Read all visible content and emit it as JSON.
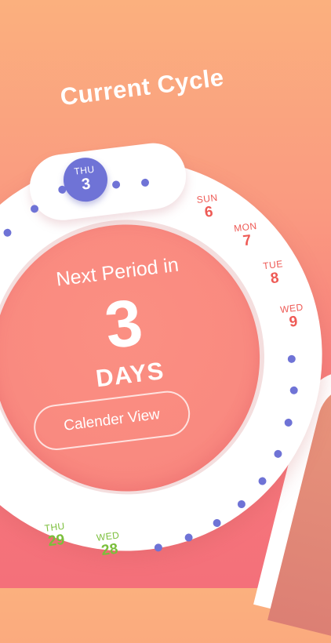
{
  "header": {
    "title": "Current Cycle"
  },
  "center": {
    "next_label": "Next Period in",
    "count": "3",
    "unit": "DAYS",
    "calendar_button": "Calender View"
  },
  "today": {
    "day": "THU",
    "date": "3"
  },
  "upcoming": [
    {
      "day": "SUN",
      "date": "6"
    },
    {
      "day": "MON",
      "date": "7"
    },
    {
      "day": "TUE",
      "date": "8"
    },
    {
      "day": "WED",
      "date": "9"
    }
  ],
  "past": [
    {
      "day": "THU",
      "date": "29"
    },
    {
      "day": "WED",
      "date": "28"
    }
  ],
  "colors": {
    "accent": "#6f73d6",
    "period_red": "#ee5a55",
    "past_green": "#7bbf3b",
    "background_top": "#fbb07e",
    "background_bottom": "#f4707a"
  }
}
